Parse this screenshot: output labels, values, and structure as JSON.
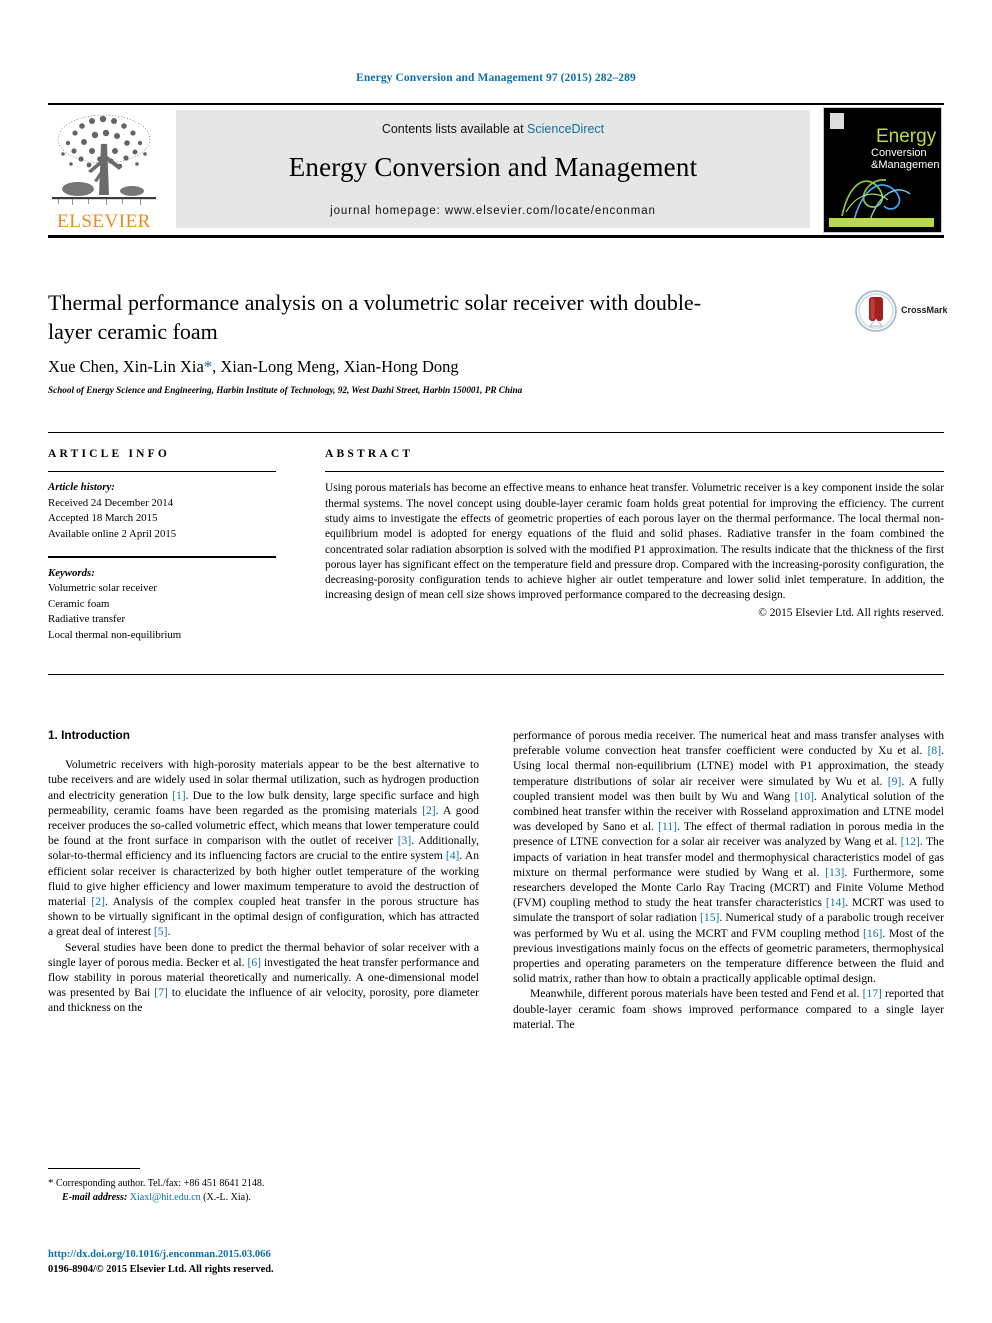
{
  "running_head": "Energy Conversion and Management 97 (2015) 282–289",
  "masthead": {
    "contents_prefix": "Contents lists available at ",
    "sciencedirect": "ScienceDirect",
    "journal_name": "Energy Conversion and Management",
    "homepage": "journal homepage: www.elsevier.com/locate/enconman",
    "publisher": "ELSEVIER",
    "cover_title_line1": "Energy",
    "cover_title_line2": "Conversion",
    "cover_title_line3": "Management",
    "link_color": "#0f6fa8",
    "publisher_color": "#eb8b22"
  },
  "article": {
    "title": "Thermal performance analysis on a volumetric solar receiver with double-layer ceramic foam",
    "authors": "Xue Chen, Xin-Lin Xia",
    "corresponding_marker": "*",
    "authors_rest": ", Xian-Long Meng, Xian-Hong Dong",
    "affiliation": "School of Energy Science and Engineering, Harbin Institute of Technology, 92, West Dazhi Street, Harbin 150001, PR China",
    "crossmark_label": "CrossMark"
  },
  "article_info": {
    "heading": "ARTICLE INFO",
    "history_label": "Article history:",
    "history": [
      "Received 24 December 2014",
      "Accepted 18 March 2015",
      "Available online 2 April 2015"
    ],
    "keywords_label": "Keywords:",
    "keywords": [
      "Volumetric solar receiver",
      "Ceramic foam",
      "Radiative transfer",
      "Local thermal non-equilibrium"
    ]
  },
  "abstract": {
    "heading": "ABSTRACT",
    "body": "Using porous materials has become an effective means to enhance heat transfer. Volumetric receiver is a key component inside the solar thermal systems. The novel concept using double-layer ceramic foam holds great potential for improving the efficiency. The current study aims to investigate the effects of geometric properties of each porous layer on the thermal performance. The local thermal non-equilibrium model is adopted for energy equations of the fluid and solid phases. Radiative transfer in the foam combined the concentrated solar radiation absorption is solved with the modified P1 approximation. The results indicate that the thickness of the first porous layer has significant effect on the temperature field and pressure drop. Compared with the increasing-porosity configuration, the decreasing-porosity configuration tends to achieve higher air outlet temperature and lower solid inlet temperature. In addition, the increasing design of mean cell size shows improved performance compared to the decreasing design.",
    "copyright": "© 2015 Elsevier Ltd. All rights reserved."
  },
  "introduction": {
    "heading": "1. Introduction",
    "left_paragraphs": [
      "Volumetric receivers with high-porosity materials appear to be the best alternative to tube receivers and are widely used in solar thermal utilization, such as hydrogen production and electricity generation [1]. Due to the low bulk density, large specific surface and high permeability, ceramic foams have been regarded as the promising materials [2]. A good receiver produces the so-called volumetric effect, which means that lower temperature could be found at the front surface in comparison with the outlet of receiver [3]. Additionally, solar-to-thermal efficiency and its influencing factors are crucial to the entire system [4]. An efficient solar receiver is characterized by both higher outlet temperature of the working fluid to give higher efficiency and lower maximum temperature to avoid the destruction of material [2]. Analysis of the complex coupled heat transfer in the porous structure has shown to be virtually significant in the optimal design of configuration, which has attracted a great deal of interest [5].",
      "Several studies have been done to predict the thermal behavior of solar receiver with a single layer of porous media. Becker et al. [6] investigated the heat transfer performance and flow stability in porous material theoretically and numerically. A one-dimensional model was presented by Bai [7] to elucidate the influence of air velocity, porosity, pore diameter and thickness on the"
    ],
    "right_paragraphs": [
      "performance of porous media receiver. The numerical heat and mass transfer analyses with preferable volume convection heat transfer coefficient were conducted by Xu et al. [8]. Using local thermal non-equilibrium (LTNE) model with P1 approximation, the steady temperature distributions of solar air receiver were simulated by Wu et al. [9]. A fully coupled transient model was then built by Wu and Wang [10]. Analytical solution of the combined heat transfer within the receiver with Rosseland approximation and LTNE model was developed by Sano et al. [11]. The effect of thermal radiation in porous media in the presence of LTNE convection for a solar air receiver was analyzed by Wang et al. [12]. The impacts of variation in heat transfer model and thermophysical characteristics model of gas mixture on thermal performance were studied by Wang et al. [13]. Furthermore, some researchers developed the Monte Carlo Ray Tracing (MCRT) and Finite Volume Method (FVM) coupling method to study the heat transfer characteristics [14]. MCRT was used to simulate the transport of solar radiation [15]. Numerical study of a parabolic trough receiver was performed by Wu et al. using the MCRT and FVM coupling method [16]. Most of the previous investigations mainly focus on the effects of geometric parameters, thermophysical properties and operating parameters on the temperature difference between the fluid and solid matrix, rather than how to obtain a practically applicable optimal design.",
      "Meanwhile, different porous materials have been tested and Fend et al. [17] reported that double-layer ceramic foam shows improved performance compared to a single layer material. The"
    ]
  },
  "footnote": {
    "marker": "*",
    "corresponding": "Corresponding author. Tel./fax: +86 451 8641 2148.",
    "email_label": "E-mail address:",
    "email": "Xiaxl@hit.edu.cn",
    "email_suffix": "(X.-L. Xia)."
  },
  "footer": {
    "doi": "http://dx.doi.org/10.1016/j.enconman.2015.03.066",
    "issn": "0196-8904/© 2015 Elsevier Ltd. All rights reserved."
  }
}
